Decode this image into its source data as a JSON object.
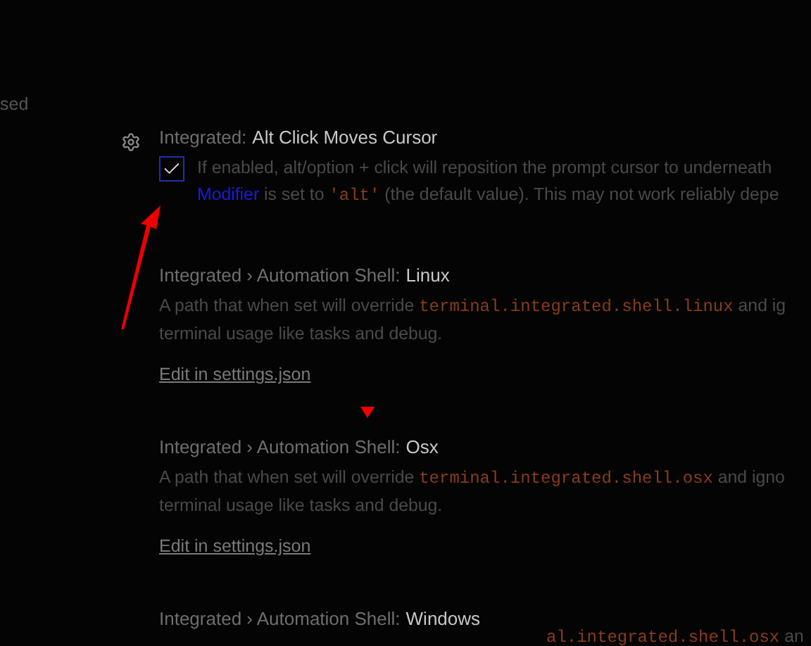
{
  "sidebar_fragment": "sed",
  "settings": [
    {
      "kind": "checkbox",
      "category": "Integrated:",
      "name": "Alt Click Moves Cursor",
      "checked": true,
      "description": [
        [
          {
            "kind": "plain",
            "text": "If enabled, alt/option + click will reposition the prompt cursor to underneath"
          }
        ],
        [
          {
            "kind": "link",
            "text": "Modifier"
          },
          {
            "kind": "plain",
            "text": " is set to "
          },
          {
            "kind": "code",
            "text": "'alt'"
          },
          {
            "kind": "plain",
            "text": " (the default value). This may not work reliably depe"
          }
        ]
      ]
    },
    {
      "kind": "json",
      "category": "Integrated › Automation Shell:",
      "name": "Linux",
      "description": [
        [
          {
            "kind": "plain",
            "text": "A path that when set will override "
          },
          {
            "kind": "code",
            "text": "terminal.integrated.shell.linux"
          },
          {
            "kind": "plain",
            "text": " and ig"
          }
        ],
        [
          {
            "kind": "plain",
            "text": "terminal usage like tasks and debug."
          }
        ]
      ],
      "link": "Edit in settings.json"
    },
    {
      "kind": "json",
      "category": "Integrated › Automation Shell:",
      "name": "Osx",
      "description": [
        [
          {
            "kind": "plain",
            "text": "A path that when set will override "
          },
          {
            "kind": "code",
            "text": "terminal.integrated.shell.osx"
          },
          {
            "kind": "plain",
            "text": " and igno"
          }
        ],
        [
          {
            "kind": "plain",
            "text": "terminal usage like tasks and debug."
          }
        ]
      ],
      "link": "Edit in settings.json"
    },
    {
      "kind": "json",
      "category": "Integrated › Automation Shell:",
      "name": "Windows"
    }
  ],
  "ghost_fragment": [
    {
      "kind": "code",
      "text": "al.integrated.shell.osx"
    },
    {
      "kind": "plain",
      "text": " an"
    }
  ]
}
